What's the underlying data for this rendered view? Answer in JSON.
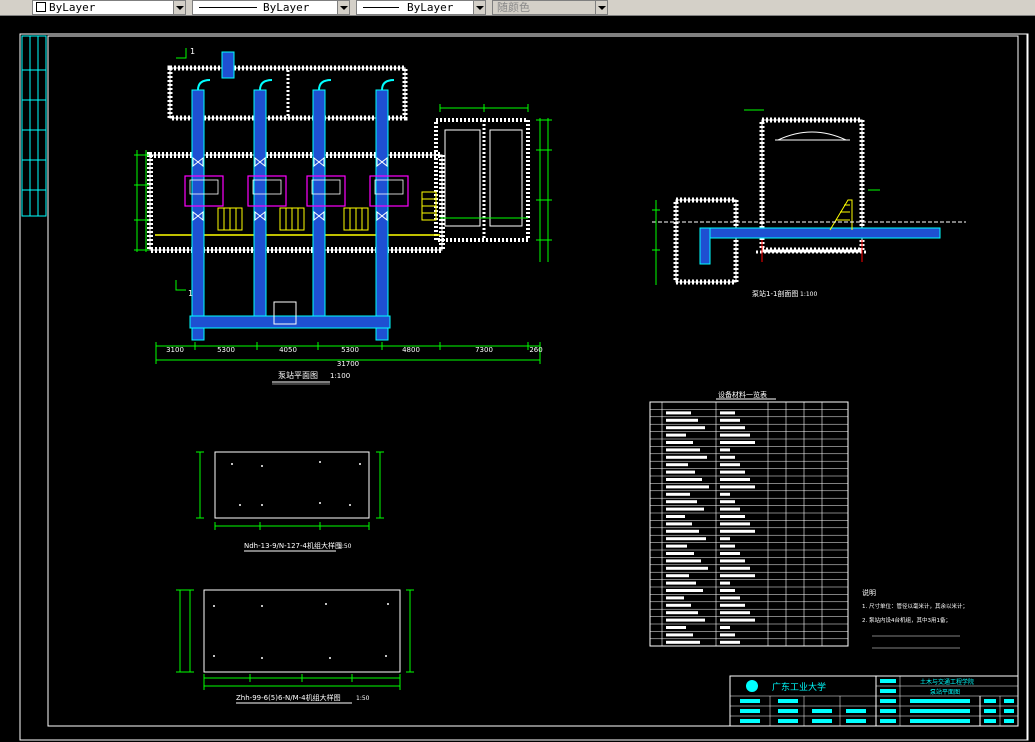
{
  "toolbar": {
    "color_combo": "ByLayer",
    "linetype_combo": "ByLayer",
    "lineweight_combo": "ByLayer",
    "plotstyle_combo": "随颜色"
  },
  "drawing": {
    "plan_title": "泵站平面图",
    "plan_scale": "1:100",
    "plan_dimensions": [
      "3100",
      "5300",
      "4050",
      "5300",
      "4800",
      "7300",
      "260"
    ],
    "plan_total": "31700",
    "section_title": "泵站1-1剖面图",
    "section_scale": "1:100",
    "detail1_title": "Ndh-13-9/N-127-4机组大样图",
    "detail1_scale": "1:50",
    "detail2_title": "Zhh-99-6(5)6-N/M-4机组大样图",
    "detail2_scale": "1:50",
    "table_title": "设备材料一览表",
    "notes_heading": "说明",
    "notes": [
      "1. 尺寸单位：管径以毫米计，其余以米计；",
      "2. 泵站内设4台机组，其中3用1备；"
    ],
    "title_block": {
      "school": "广东工业大学",
      "project": "土木与交通工程学院",
      "drawing_name": "泵站平面图"
    }
  }
}
